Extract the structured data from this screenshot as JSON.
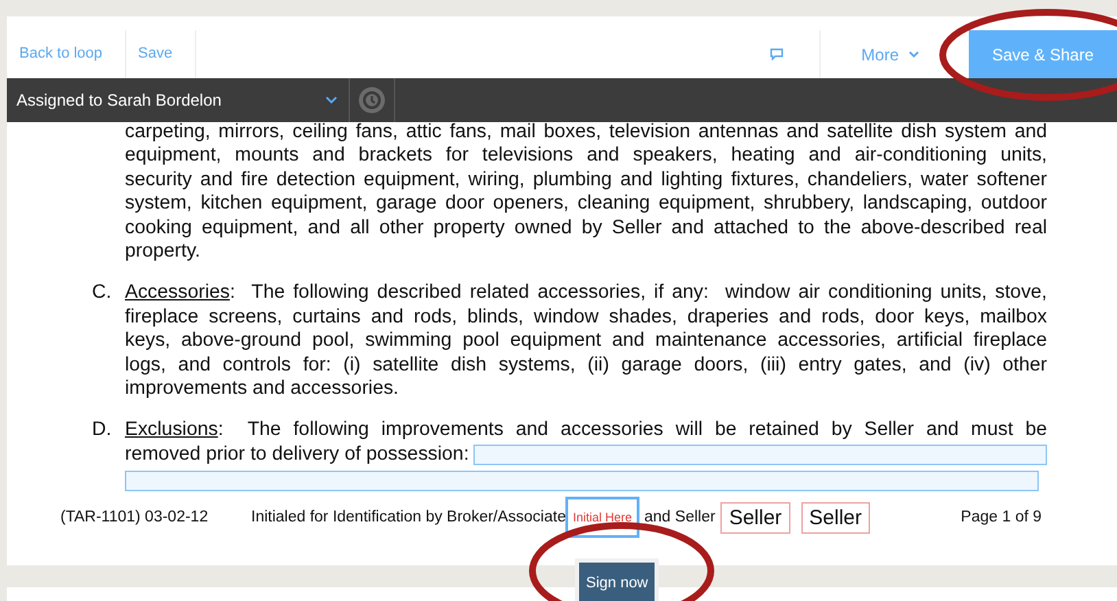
{
  "toolbar": {
    "links": [
      {
        "label": "Back to loop"
      },
      {
        "label": "Save"
      }
    ],
    "more": {
      "label": "More"
    },
    "primary": {
      "label": "Save & Share"
    }
  },
  "assign_bar": {
    "label": "Assigned to Sarah Bordelon"
  },
  "document": {
    "lead": [
      "carpeting, mirrors, ceiling fans, attic fans, mail boxes, television antennas and satellite dish system and",
      "equipment, mounts and brackets for televisions and speakers, heating and air-conditioning units,",
      "security and fire detection equipment, wiring, plumbing and lighting fixtures, chandeliers, water softener",
      "system, kitchen equipment, garage door openers, cleaning equipment, shrubbery, landscaping, outdoor",
      "cooking equipment, and all other property owned by Seller and attached to the above-described real",
      "property."
    ],
    "items": [
      {
        "letter": "C.",
        "heading": "Accessories",
        "first_line": ":  The following described related accessories, if any:  window air conditioning units, stove,",
        "lines": [
          "fireplace screens, curtains and rods, blinds, window shades, draperies and rods, door keys, mailbox",
          "keys, above-ground pool, swimming pool equipment and maintenance accessories, artificial fireplace",
          "logs, and controls for: (i) satellite dish systems, (ii) garage doors, (iii) entry gates, and (iv) other",
          "improvements and accessories."
        ],
        "has_field": false
      },
      {
        "letter": "D.",
        "heading": "Exclusions",
        "first_line": ":  The following improvements and accessories will be retained by Seller and must be",
        "lines": [
          "removed prior to delivery of possession:"
        ],
        "has_field": true
      }
    ],
    "footer": {
      "form_id": "(TAR-1101) 03-02-12",
      "initial_text": "Initialed for Identification by Broker/Associate",
      "initial_box": "Initial Here",
      "and_seller": "and Seller",
      "seller_boxes": [
        "Seller",
        "Seller"
      ],
      "page": "Page 1 of 9"
    }
  },
  "tooltip": {
    "label": "Sign now"
  }
}
